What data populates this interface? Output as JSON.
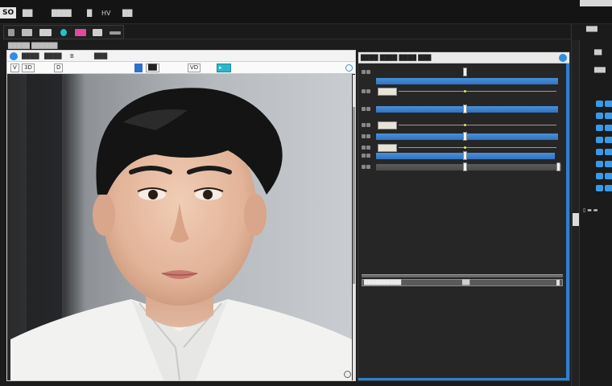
{
  "menubar": {
    "logo": "SO",
    "items": [
      "██",
      "████",
      "█",
      "HV",
      "██"
    ]
  },
  "path_label": "█████ ██████",
  "photo_window": {
    "tabs": [
      "████",
      "████",
      "B",
      "███"
    ],
    "tools": [
      "V",
      "3D",
      "D",
      "██",
      "VD",
      "▸"
    ],
    "image_subject": "portrait-photo"
  },
  "tracks_panel": {
    "title": "████ ████ ████ ███",
    "timeline_label": "██████████",
    "timeline_mid": "██"
  },
  "side_panel": {
    "title": "███",
    "label_a": "██",
    "label_b": "███"
  },
  "colors": {
    "accent": "#2f8fe0",
    "track_bar": "#3c82cf",
    "cyan_tool": "#2bb7c9"
  }
}
